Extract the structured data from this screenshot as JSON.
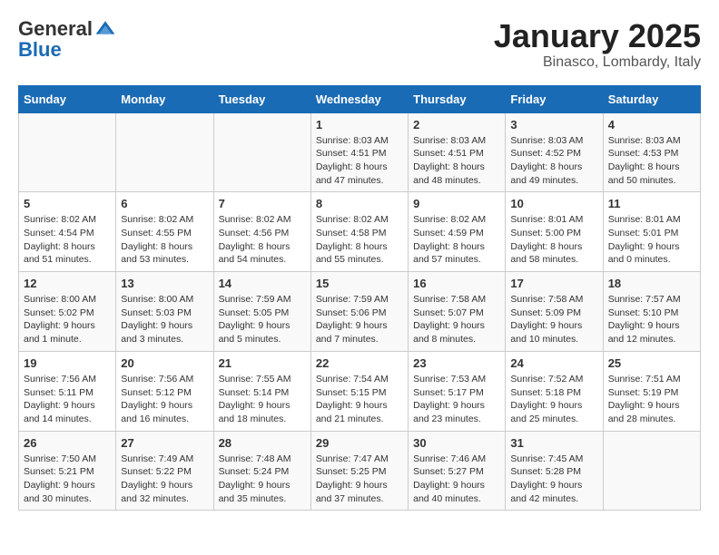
{
  "header": {
    "logo_general": "General",
    "logo_blue": "Blue",
    "month": "January 2025",
    "location": "Binasco, Lombardy, Italy"
  },
  "weekdays": [
    "Sunday",
    "Monday",
    "Tuesday",
    "Wednesday",
    "Thursday",
    "Friday",
    "Saturday"
  ],
  "weeks": [
    [
      {
        "day": "",
        "text": ""
      },
      {
        "day": "",
        "text": ""
      },
      {
        "day": "",
        "text": ""
      },
      {
        "day": "1",
        "text": "Sunrise: 8:03 AM\nSunset: 4:51 PM\nDaylight: 8 hours and 47 minutes."
      },
      {
        "day": "2",
        "text": "Sunrise: 8:03 AM\nSunset: 4:51 PM\nDaylight: 8 hours and 48 minutes."
      },
      {
        "day": "3",
        "text": "Sunrise: 8:03 AM\nSunset: 4:52 PM\nDaylight: 8 hours and 49 minutes."
      },
      {
        "day": "4",
        "text": "Sunrise: 8:03 AM\nSunset: 4:53 PM\nDaylight: 8 hours and 50 minutes."
      }
    ],
    [
      {
        "day": "5",
        "text": "Sunrise: 8:02 AM\nSunset: 4:54 PM\nDaylight: 8 hours and 51 minutes."
      },
      {
        "day": "6",
        "text": "Sunrise: 8:02 AM\nSunset: 4:55 PM\nDaylight: 8 hours and 53 minutes."
      },
      {
        "day": "7",
        "text": "Sunrise: 8:02 AM\nSunset: 4:56 PM\nDaylight: 8 hours and 54 minutes."
      },
      {
        "day": "8",
        "text": "Sunrise: 8:02 AM\nSunset: 4:58 PM\nDaylight: 8 hours and 55 minutes."
      },
      {
        "day": "9",
        "text": "Sunrise: 8:02 AM\nSunset: 4:59 PM\nDaylight: 8 hours and 57 minutes."
      },
      {
        "day": "10",
        "text": "Sunrise: 8:01 AM\nSunset: 5:00 PM\nDaylight: 8 hours and 58 minutes."
      },
      {
        "day": "11",
        "text": "Sunrise: 8:01 AM\nSunset: 5:01 PM\nDaylight: 9 hours and 0 minutes."
      }
    ],
    [
      {
        "day": "12",
        "text": "Sunrise: 8:00 AM\nSunset: 5:02 PM\nDaylight: 9 hours and 1 minute."
      },
      {
        "day": "13",
        "text": "Sunrise: 8:00 AM\nSunset: 5:03 PM\nDaylight: 9 hours and 3 minutes."
      },
      {
        "day": "14",
        "text": "Sunrise: 7:59 AM\nSunset: 5:05 PM\nDaylight: 9 hours and 5 minutes."
      },
      {
        "day": "15",
        "text": "Sunrise: 7:59 AM\nSunset: 5:06 PM\nDaylight: 9 hours and 7 minutes."
      },
      {
        "day": "16",
        "text": "Sunrise: 7:58 AM\nSunset: 5:07 PM\nDaylight: 9 hours and 8 minutes."
      },
      {
        "day": "17",
        "text": "Sunrise: 7:58 AM\nSunset: 5:09 PM\nDaylight: 9 hours and 10 minutes."
      },
      {
        "day": "18",
        "text": "Sunrise: 7:57 AM\nSunset: 5:10 PM\nDaylight: 9 hours and 12 minutes."
      }
    ],
    [
      {
        "day": "19",
        "text": "Sunrise: 7:56 AM\nSunset: 5:11 PM\nDaylight: 9 hours and 14 minutes."
      },
      {
        "day": "20",
        "text": "Sunrise: 7:56 AM\nSunset: 5:12 PM\nDaylight: 9 hours and 16 minutes."
      },
      {
        "day": "21",
        "text": "Sunrise: 7:55 AM\nSunset: 5:14 PM\nDaylight: 9 hours and 18 minutes."
      },
      {
        "day": "22",
        "text": "Sunrise: 7:54 AM\nSunset: 5:15 PM\nDaylight: 9 hours and 21 minutes."
      },
      {
        "day": "23",
        "text": "Sunrise: 7:53 AM\nSunset: 5:17 PM\nDaylight: 9 hours and 23 minutes."
      },
      {
        "day": "24",
        "text": "Sunrise: 7:52 AM\nSunset: 5:18 PM\nDaylight: 9 hours and 25 minutes."
      },
      {
        "day": "25",
        "text": "Sunrise: 7:51 AM\nSunset: 5:19 PM\nDaylight: 9 hours and 28 minutes."
      }
    ],
    [
      {
        "day": "26",
        "text": "Sunrise: 7:50 AM\nSunset: 5:21 PM\nDaylight: 9 hours and 30 minutes."
      },
      {
        "day": "27",
        "text": "Sunrise: 7:49 AM\nSunset: 5:22 PM\nDaylight: 9 hours and 32 minutes."
      },
      {
        "day": "28",
        "text": "Sunrise: 7:48 AM\nSunset: 5:24 PM\nDaylight: 9 hours and 35 minutes."
      },
      {
        "day": "29",
        "text": "Sunrise: 7:47 AM\nSunset: 5:25 PM\nDaylight: 9 hours and 37 minutes."
      },
      {
        "day": "30",
        "text": "Sunrise: 7:46 AM\nSunset: 5:27 PM\nDaylight: 9 hours and 40 minutes."
      },
      {
        "day": "31",
        "text": "Sunrise: 7:45 AM\nSunset: 5:28 PM\nDaylight: 9 hours and 42 minutes."
      },
      {
        "day": "",
        "text": ""
      }
    ]
  ]
}
